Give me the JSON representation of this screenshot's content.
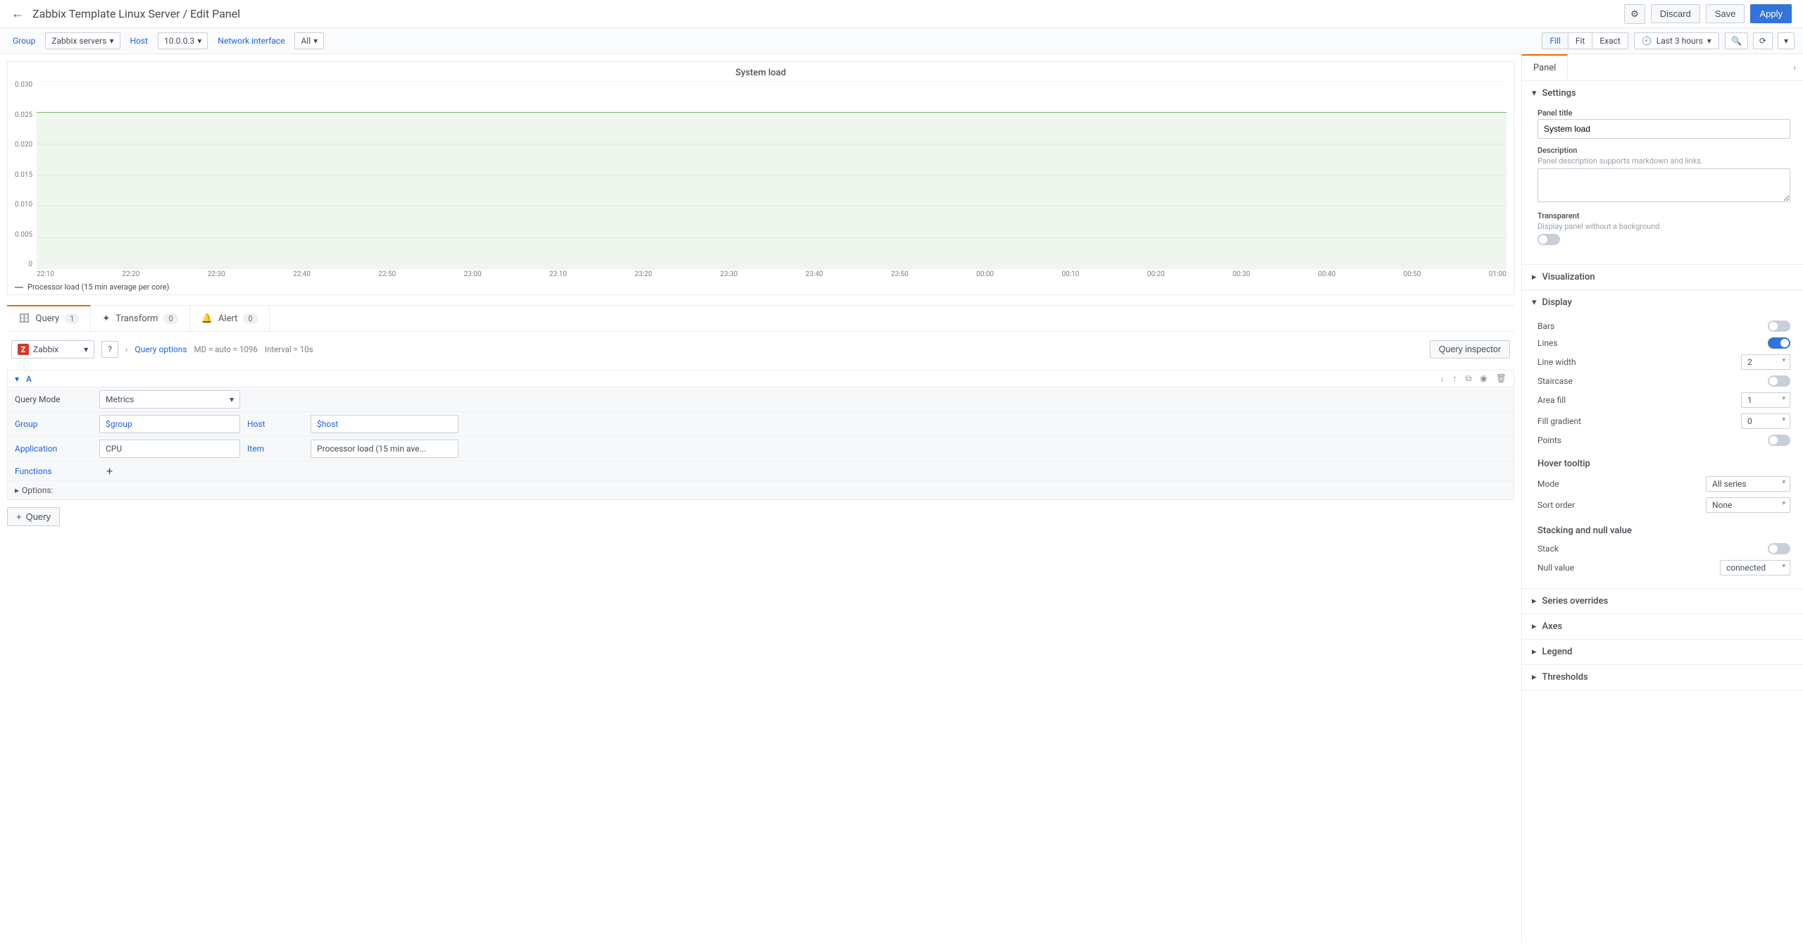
{
  "header": {
    "title": "Zabbix Template Linux Server / Edit Panel",
    "discard": "Discard",
    "save": "Save",
    "apply": "Apply"
  },
  "varbar": {
    "group_label": "Group",
    "group_value": "Zabbix servers",
    "host_label": "Host",
    "host_value": "10.0.0.3",
    "netif_label": "Network interface",
    "netif_value": "All",
    "fill": "Fill",
    "fit": "Fit",
    "exact": "Exact",
    "time_range": "Last 3 hours"
  },
  "chart_data": {
    "type": "line",
    "title": "System load",
    "series": [
      {
        "name": "Processor load (15 min average per core)",
        "flat_value": 0.025
      }
    ],
    "y_ticks": [
      "0.030",
      "0.025",
      "0.020",
      "0.015",
      "0.010",
      "0.005",
      "0"
    ],
    "x_ticks": [
      "22:10",
      "22:20",
      "22:30",
      "22:40",
      "22:50",
      "23:00",
      "23:10",
      "23:20",
      "23:30",
      "23:40",
      "23:50",
      "00:00",
      "00:10",
      "00:20",
      "00:30",
      "00:40",
      "00:50",
      "01:00"
    ],
    "ylim": [
      0,
      0.03
    ]
  },
  "editor_tabs": {
    "query": "Query",
    "query_count": "1",
    "transform": "Transform",
    "transform_count": "0",
    "alert": "Alert",
    "alert_count": "0"
  },
  "datasource": {
    "name": "Zabbix",
    "options_label": "Query options",
    "md_label": "MD = auto = 1096",
    "interval_label": "Interval = 10s",
    "inspector": "Query inspector"
  },
  "queryA": {
    "letter": "A",
    "mode_label": "Query Mode",
    "mode_value": "Metrics",
    "group_label": "Group",
    "group_value": "$group",
    "host_label": "Host",
    "host_value": "$host",
    "app_label": "Application",
    "app_value": "CPU",
    "item_label": "Item",
    "item_value": "Processor load (15 min ave...",
    "functions_label": "Functions",
    "options_label": "Options:"
  },
  "add_query": "Query",
  "side": {
    "tab": "Panel",
    "settings": "Settings",
    "panel_title_label": "Panel title",
    "panel_title_value": "System load",
    "desc_label": "Description",
    "desc_help": "Panel description supports markdown and links.",
    "transparent_label": "Transparent",
    "transparent_help": "Display panel without a background.",
    "visualization": "Visualization",
    "display": "Display",
    "bars": "Bars",
    "lines": "Lines",
    "line_width": "Line width",
    "line_width_val": "2",
    "staircase": "Staircase",
    "area_fill": "Area fill",
    "area_fill_val": "1",
    "fill_gradient": "Fill gradient",
    "fill_gradient_val": "0",
    "points": "Points",
    "hover_tooltip": "Hover tooltip",
    "mode_label": "Mode",
    "mode_val": "All series",
    "sort_label": "Sort order",
    "sort_val": "None",
    "stacking_null": "Stacking and null value",
    "stack": "Stack",
    "null_value": "Null value",
    "null_value_val": "connected",
    "series_overrides": "Series overrides",
    "axes": "Axes",
    "legend": "Legend",
    "thresholds": "Thresholds"
  }
}
